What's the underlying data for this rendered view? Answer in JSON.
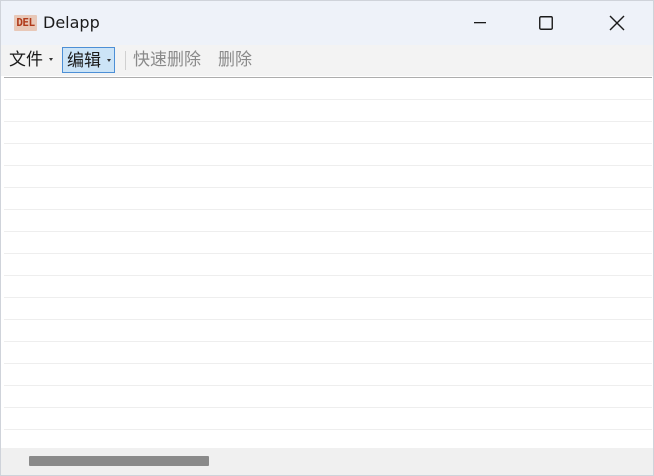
{
  "window": {
    "title": "Delapp",
    "icon_text": "DEL",
    "icon_name": "app-del-icon",
    "controls": [
      "minimize-icon",
      "maximize-icon",
      "close-icon"
    ]
  },
  "menubar": {
    "items": [
      {
        "label": "文件",
        "has_dropdown": true,
        "state": "normal"
      },
      {
        "label": "编辑",
        "has_dropdown": true,
        "state": "active"
      },
      {
        "label": "快速删除",
        "has_dropdown": false,
        "state": "disabled"
      },
      {
        "label": "删除",
        "has_dropdown": false,
        "state": "disabled"
      }
    ]
  },
  "list": {
    "rows": []
  },
  "colors": {
    "titlebar_bg": "#eef2f9",
    "menubar_bg": "#f3f3f3",
    "active_menu_bg": "#cce4f7",
    "active_menu_border": "#4c8fd6",
    "disabled_text": "#8a8a8a",
    "scroll_thumb": "#8a8a8a"
  }
}
